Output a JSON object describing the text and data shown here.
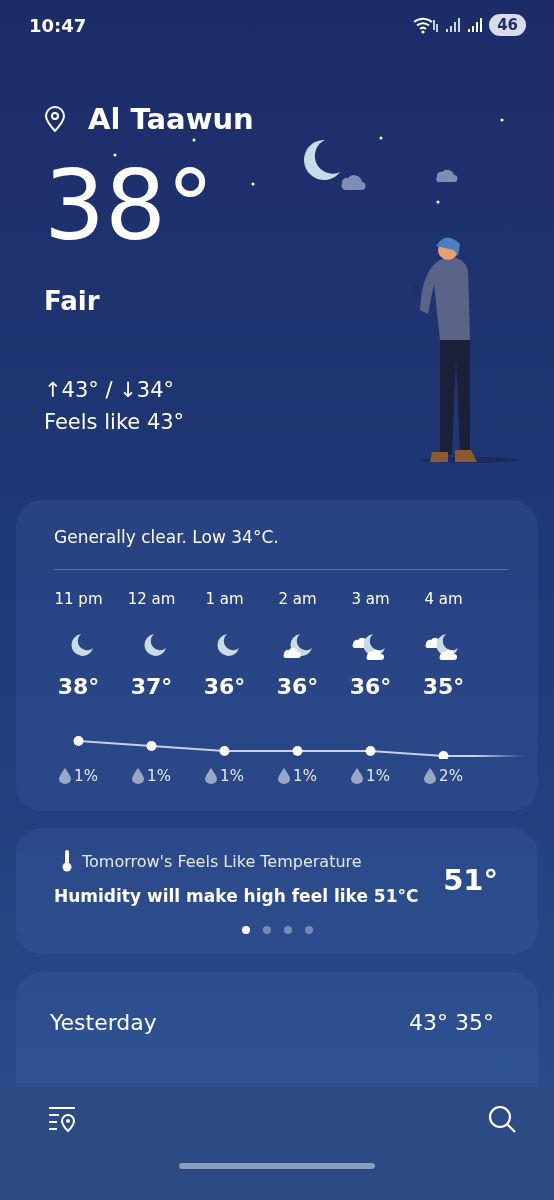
{
  "status_bar": {
    "time": "10:47",
    "battery": "46"
  },
  "location": {
    "name": "Al Taawun"
  },
  "current": {
    "temperature": "38°",
    "condition": "Fair",
    "high_low": "↑43° / ↓34°",
    "feels_like": "Feels like 43°"
  },
  "hourly": {
    "summary": "Generally clear. Low 34°C.",
    "hours": [
      {
        "time": "11 pm",
        "kind": "clear",
        "temp": "38°",
        "precip": "1%"
      },
      {
        "time": "12 am",
        "kind": "clear",
        "temp": "37°",
        "precip": "1%"
      },
      {
        "time": "1 am",
        "kind": "clear",
        "temp": "36°",
        "precip": "1%"
      },
      {
        "time": "2 am",
        "kind": "partly-cloudy",
        "temp": "36°",
        "precip": "1%"
      },
      {
        "time": "3 am",
        "kind": "mostly-cloudy",
        "temp": "36°",
        "precip": "1%"
      },
      {
        "time": "4 am",
        "kind": "mostly-cloudy",
        "temp": "35°",
        "precip": "2%"
      }
    ]
  },
  "insight": {
    "title": "Tomorrow's Feels Like Temperature",
    "text": "Humidity will make high feel like 51°C",
    "value": "51°",
    "pages": [
      {
        "selected": true
      },
      {
        "selected": false
      },
      {
        "selected": false
      },
      {
        "selected": false
      }
    ]
  },
  "daily": [
    {
      "day": "Yesterday",
      "temps": "43° 35°"
    }
  ]
}
